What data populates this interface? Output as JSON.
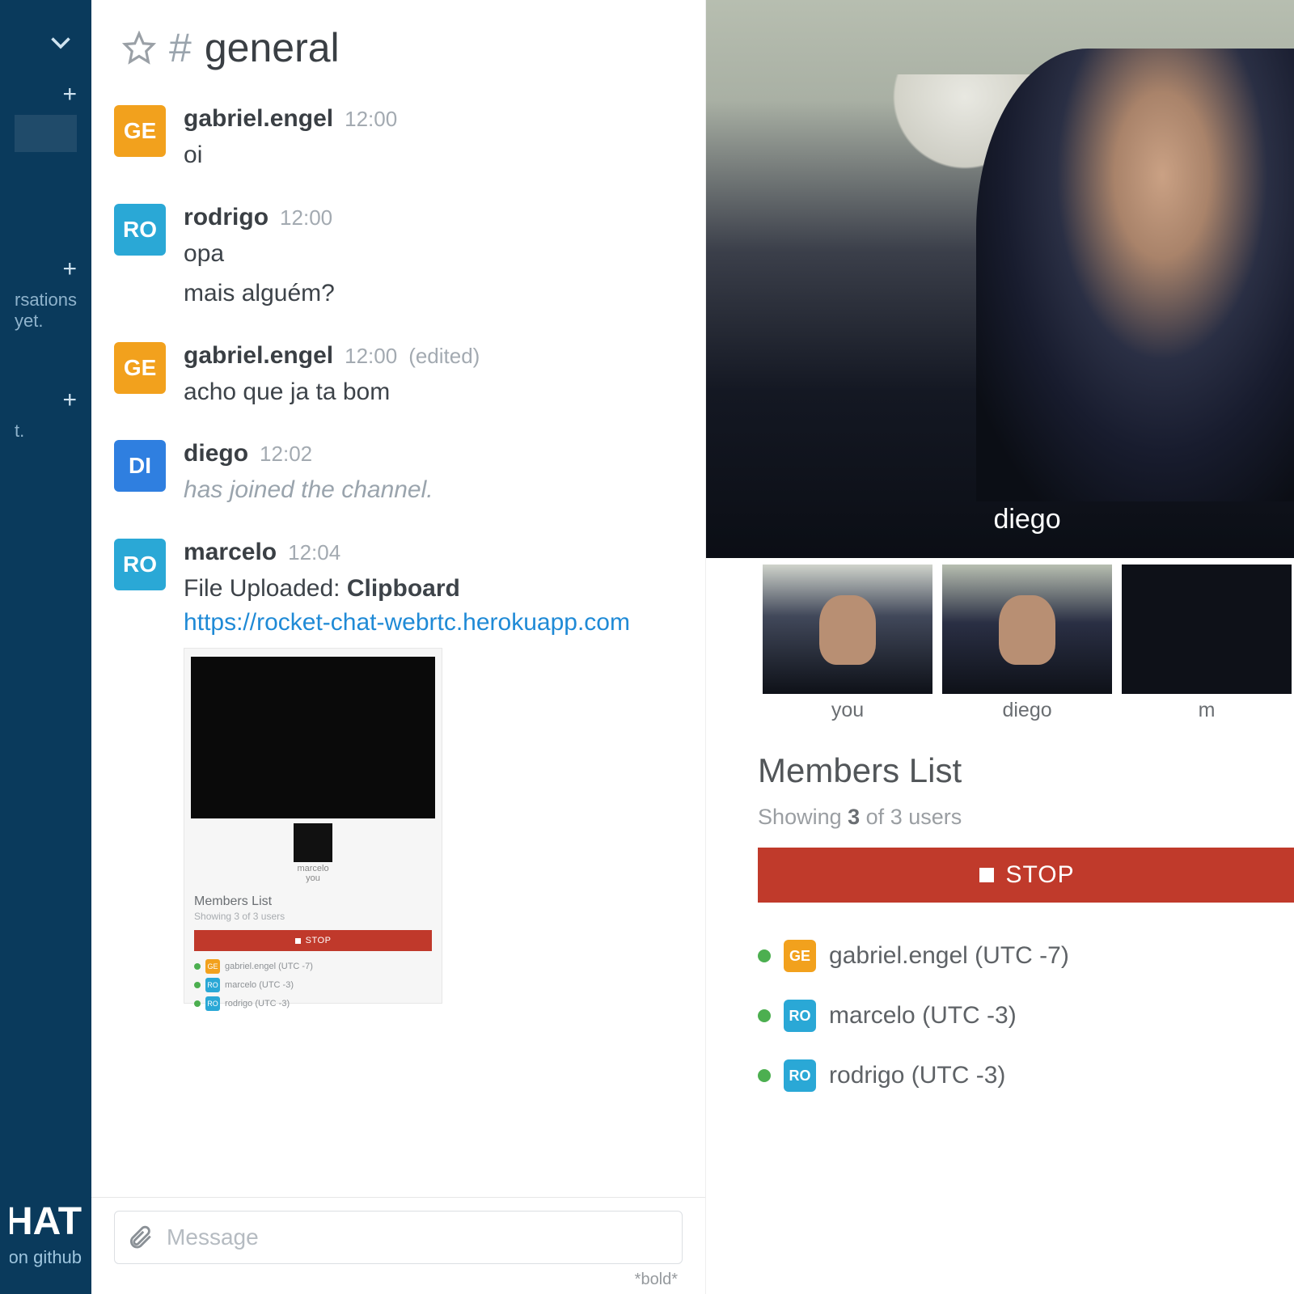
{
  "sidebar": {
    "no_conversations": "rsations yet.",
    "hint2": "t.",
    "brand": "T.CHAT",
    "brand_sub": "fork it on github"
  },
  "channel": {
    "name": "general"
  },
  "avatars": {
    "GE": "GE",
    "RO": "RO",
    "DI": "DI"
  },
  "messages": [
    {
      "user": "gabriel.engel",
      "time": "12:00",
      "avatar": "GE",
      "lines": [
        "oi"
      ]
    },
    {
      "user": "rodrigo",
      "time": "12:00",
      "avatar": "RO",
      "lines": [
        "opa",
        "mais alguém?"
      ]
    },
    {
      "user": "gabriel.engel",
      "time": "12:00",
      "edited": "(edited)",
      "avatar": "GE",
      "lines": [
        "acho que ja ta bom"
      ]
    },
    {
      "user": "diego",
      "time": "12:02",
      "avatar": "DI",
      "system": "has joined the channel."
    },
    {
      "user": "marcelo",
      "time": "12:04",
      "avatar": "RO",
      "upload_prefix": "File Uploaded: ",
      "upload_name": "Clipboard",
      "link": "https://rocket-chat-webrtc.herokuapp.com"
    }
  ],
  "attachment": {
    "thumb_label": "marcelo",
    "you": "you",
    "ml": "Members List",
    "sub": "Showing 3 of 3 users",
    "stop": "STOP",
    "rows": [
      {
        "av": "GE",
        "t": "gabriel.engel (UTC -7)"
      },
      {
        "av": "RO",
        "t": "marcelo (UTC -3)"
      },
      {
        "av": "RO",
        "t": "rodrigo (UTC -3)"
      }
    ]
  },
  "composer": {
    "placeholder": "Message",
    "format_hint": "*bold*"
  },
  "video": {
    "main_label": "diego",
    "thumbs": [
      {
        "label": "you",
        "cls": "you"
      },
      {
        "label": "diego",
        "cls": "diego"
      },
      {
        "label": "m",
        "cls": ""
      }
    ]
  },
  "members": {
    "title": "Members List",
    "showing_prefix": "Showing ",
    "count": "3",
    "showing_mid": " of ",
    "total": "3",
    "showing_suffix": " users",
    "stop": "STOP",
    "list": [
      {
        "av": "GE",
        "av_cls": "av-GE",
        "name": "gabriel.engel (UTC -7)"
      },
      {
        "av": "RO",
        "av_cls": "av-RO",
        "name": "marcelo (UTC -3)"
      },
      {
        "av": "RO",
        "av_cls": "av-RO",
        "name": "rodrigo (UTC -3)"
      }
    ]
  }
}
